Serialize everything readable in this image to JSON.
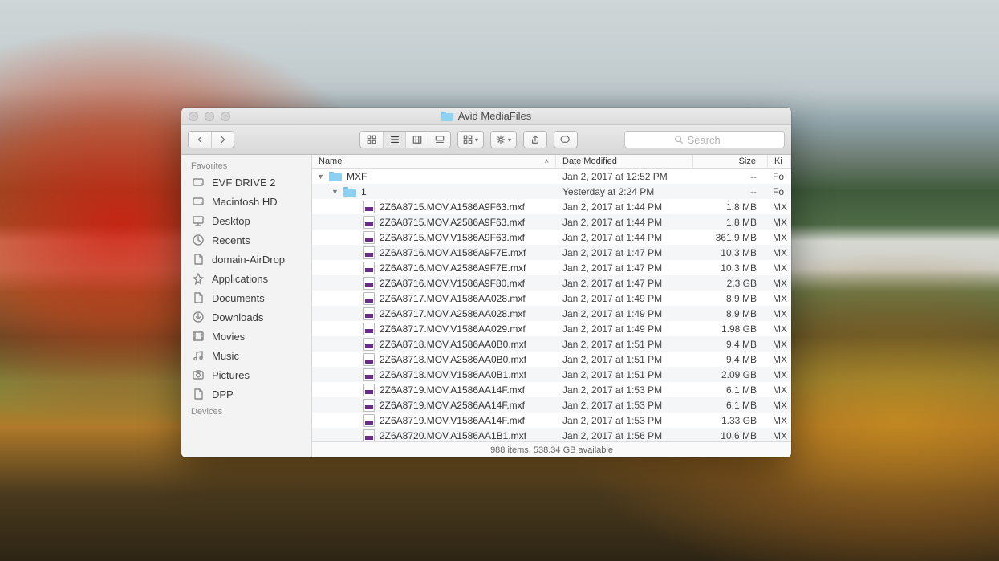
{
  "window": {
    "title": "Avid MediaFiles"
  },
  "toolbar": {
    "search_placeholder": "Search"
  },
  "sidebar": {
    "favorites_heading": "Favorites",
    "devices_heading": "Devices",
    "items": [
      {
        "id": "evf-drive-2",
        "label": "EVF DRIVE 2",
        "icon": "drive-icon",
        "selected": false
      },
      {
        "id": "macintosh-hd",
        "label": "Macintosh HD",
        "icon": "drive-icon",
        "selected": false
      },
      {
        "id": "desktop",
        "label": "Desktop",
        "icon": "desktop-icon",
        "selected": false
      },
      {
        "id": "recents",
        "label": "Recents",
        "icon": "recent-icon",
        "selected": false
      },
      {
        "id": "domain-airdrop",
        "label": "domain-AirDrop",
        "icon": "document-icon",
        "selected": false
      },
      {
        "id": "applications",
        "label": "Applications",
        "icon": "apps-icon",
        "selected": false
      },
      {
        "id": "documents",
        "label": "Documents",
        "icon": "document-icon",
        "selected": false
      },
      {
        "id": "downloads",
        "label": "Downloads",
        "icon": "download-icon",
        "selected": false
      },
      {
        "id": "movies",
        "label": "Movies",
        "icon": "movies-icon",
        "selected": false
      },
      {
        "id": "music",
        "label": "Music",
        "icon": "music-icon",
        "selected": false
      },
      {
        "id": "pictures",
        "label": "Pictures",
        "icon": "pictures-icon",
        "selected": false
      },
      {
        "id": "dpp",
        "label": "DPP",
        "icon": "document-icon",
        "selected": false
      }
    ]
  },
  "columns": {
    "name": "Name",
    "date": "Date Modified",
    "size": "Size",
    "kind": "Kind",
    "kind_truncated": "Ki"
  },
  "rows": [
    {
      "indent": 0,
      "type": "folder",
      "disclosure": "open",
      "name": "MXF",
      "date": "Jan 2, 2017 at 12:52 PM",
      "size": "--",
      "kind": "Fo"
    },
    {
      "indent": 1,
      "type": "folder",
      "disclosure": "open",
      "name": "1",
      "date": "Yesterday at 2:24 PM",
      "size": "--",
      "kind": "Fo"
    },
    {
      "indent": 2,
      "type": "file",
      "name": "2Z6A8715.MOV.A1586A9F63.mxf",
      "date": "Jan 2, 2017 at 1:44 PM",
      "size": "1.8 MB",
      "kind": "MX"
    },
    {
      "indent": 2,
      "type": "file",
      "name": "2Z6A8715.MOV.A2586A9F63.mxf",
      "date": "Jan 2, 2017 at 1:44 PM",
      "size": "1.8 MB",
      "kind": "MX"
    },
    {
      "indent": 2,
      "type": "file",
      "name": "2Z6A8715.MOV.V1586A9F63.mxf",
      "date": "Jan 2, 2017 at 1:44 PM",
      "size": "361.9 MB",
      "kind": "MX"
    },
    {
      "indent": 2,
      "type": "file",
      "name": "2Z6A8716.MOV.A1586A9F7E.mxf",
      "date": "Jan 2, 2017 at 1:47 PM",
      "size": "10.3 MB",
      "kind": "MX"
    },
    {
      "indent": 2,
      "type": "file",
      "name": "2Z6A8716.MOV.A2586A9F7E.mxf",
      "date": "Jan 2, 2017 at 1:47 PM",
      "size": "10.3 MB",
      "kind": "MX"
    },
    {
      "indent": 2,
      "type": "file",
      "name": "2Z6A8716.MOV.V1586A9F80.mxf",
      "date": "Jan 2, 2017 at 1:47 PM",
      "size": "2.3 GB",
      "kind": "MX"
    },
    {
      "indent": 2,
      "type": "file",
      "name": "2Z6A8717.MOV.A1586AA028.mxf",
      "date": "Jan 2, 2017 at 1:49 PM",
      "size": "8.9 MB",
      "kind": "MX"
    },
    {
      "indent": 2,
      "type": "file",
      "name": "2Z6A8717.MOV.A2586AA028.mxf",
      "date": "Jan 2, 2017 at 1:49 PM",
      "size": "8.9 MB",
      "kind": "MX"
    },
    {
      "indent": 2,
      "type": "file",
      "name": "2Z6A8717.MOV.V1586AA029.mxf",
      "date": "Jan 2, 2017 at 1:49 PM",
      "size": "1.98 GB",
      "kind": "MX"
    },
    {
      "indent": 2,
      "type": "file",
      "name": "2Z6A8718.MOV.A1586AA0B0.mxf",
      "date": "Jan 2, 2017 at 1:51 PM",
      "size": "9.4 MB",
      "kind": "MX"
    },
    {
      "indent": 2,
      "type": "file",
      "name": "2Z6A8718.MOV.A2586AA0B0.mxf",
      "date": "Jan 2, 2017 at 1:51 PM",
      "size": "9.4 MB",
      "kind": "MX"
    },
    {
      "indent": 2,
      "type": "file",
      "name": "2Z6A8718.MOV.V1586AA0B1.mxf",
      "date": "Jan 2, 2017 at 1:51 PM",
      "size": "2.09 GB",
      "kind": "MX"
    },
    {
      "indent": 2,
      "type": "file",
      "name": "2Z6A8719.MOV.A1586AA14F.mxf",
      "date": "Jan 2, 2017 at 1:53 PM",
      "size": "6.1 MB",
      "kind": "MX"
    },
    {
      "indent": 2,
      "type": "file",
      "name": "2Z6A8719.MOV.A2586AA14F.mxf",
      "date": "Jan 2, 2017 at 1:53 PM",
      "size": "6.1 MB",
      "kind": "MX"
    },
    {
      "indent": 2,
      "type": "file",
      "name": "2Z6A8719.MOV.V1586AA14F.mxf",
      "date": "Jan 2, 2017 at 1:53 PM",
      "size": "1.33 GB",
      "kind": "MX"
    },
    {
      "indent": 2,
      "type": "file",
      "name": "2Z6A8720.MOV.A1586AA1B1.mxf",
      "date": "Jan 2, 2017 at 1:56 PM",
      "size": "10.6 MB",
      "kind": "MX"
    }
  ],
  "status": "988 items, 538.34 GB available"
}
